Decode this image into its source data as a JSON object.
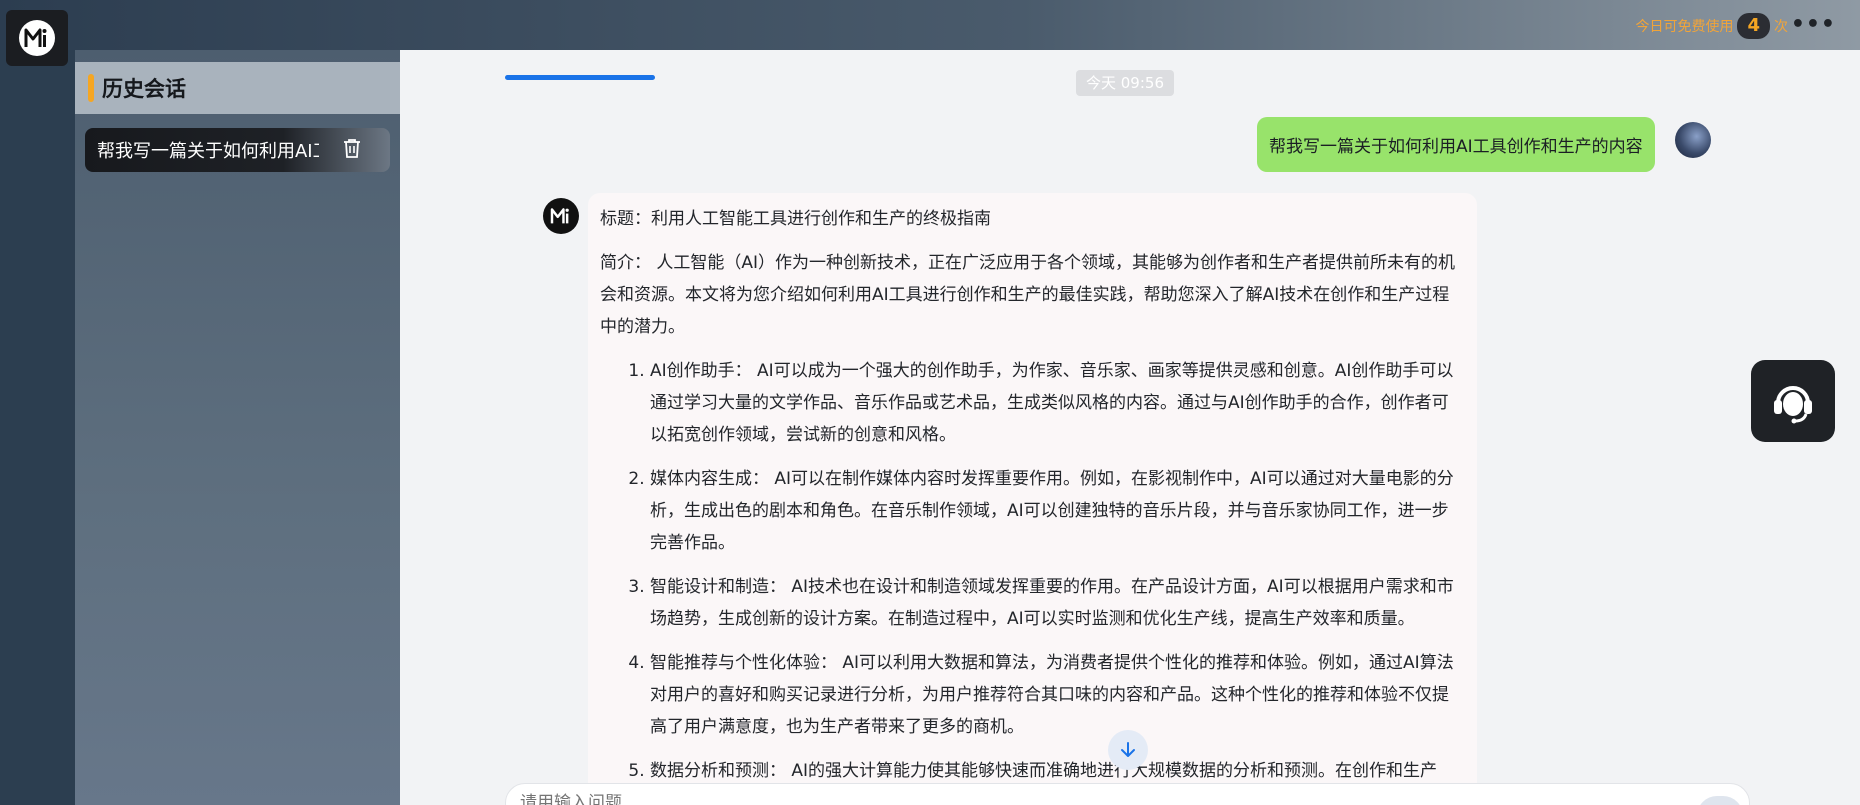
{
  "topbar": {
    "quota_prefix": "今日可免费使用",
    "quota_count": "4",
    "quota_suffix": "次",
    "more_icon": "more-horizontal-icon"
  },
  "sidebar": {
    "title": "历史会话",
    "history": [
      {
        "label": "帮我写一篇关于如何利用AI工具创作和生产的内容"
      }
    ]
  },
  "chat": {
    "timestamp": "今天 09:56",
    "user_message": "帮我写一篇关于如何利用AI工具创作和生产的内容",
    "bot": {
      "title_line": "标题：利用人工智能工具进行创作和生产的终极指南",
      "intro": "简介： 人工智能（AI）作为一种创新技术，正在广泛应用于各个领域，其能够为创作者和生产者提供前所未有的机会和资源。本文将为您介绍如何利用AI工具进行创作和生产的最佳实践，帮助您深入了解AI技术在创作和生产过程中的潜力。",
      "items": [
        "AI创作助手： AI可以成为一个强大的创作助手，为作家、音乐家、画家等提供灵感和创意。AI创作助手可以通过学习大量的文学作品、音乐作品或艺术品，生成类似风格的内容。通过与AI创作助手的合作，创作者可以拓宽创作领域，尝试新的创意和风格。",
        "媒体内容生成： AI可以在制作媒体内容时发挥重要作用。例如，在影视制作中，AI可以通过对大量电影的分析，生成出色的剧本和角色。在音乐制作领域，AI可以创建独特的音乐片段，并与音乐家协同工作，进一步完善作品。",
        "智能设计和制造： AI技术也在设计和制造领域发挥重要的作用。在产品设计方面，AI可以根据用户需求和市场趋势，生成创新的设计方案。在制造过程中，AI可以实时监测和优化生产线，提高生产效率和质量。",
        "智能推荐与个性化体验： AI可以利用大数据和算法，为消费者提供个性化的推荐和体验。例如，通过AI算法对用户的喜好和购买记录进行分析，为用户推荐符合其口味的内容和产品。这种个性化的推荐和体验不仅提高了用户满意度，也为生产者带来了更多的商机。",
        "数据分析和预测： AI的强大计算能力使其能够快速而准确地进行大规模数据的分析和预测。在创作和生产"
      ]
    },
    "input_placeholder": "请用输入问题"
  },
  "colors": {
    "accent": "#f5a623",
    "user_bubble": "#98e36b",
    "progress": "#1a73e8"
  }
}
